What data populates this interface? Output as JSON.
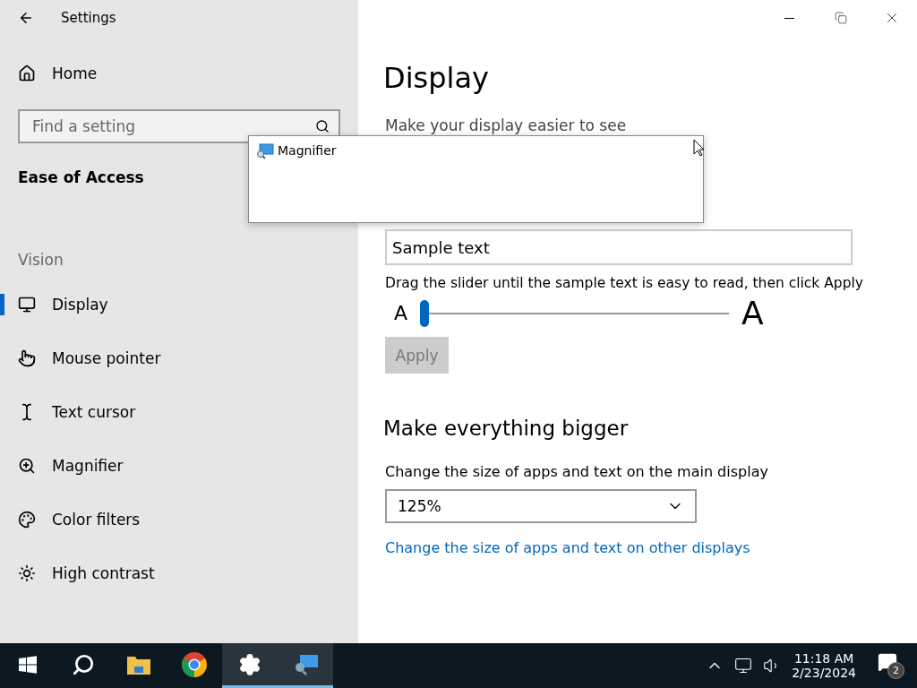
{
  "window": {
    "title": "Settings"
  },
  "sidebar": {
    "home": "Home",
    "search": {
      "placeholder": "Find a setting"
    },
    "section": "Ease of Access",
    "group": "Vision",
    "items": [
      {
        "label": "Display",
        "selected": true
      },
      {
        "label": "Mouse pointer",
        "selected": false
      },
      {
        "label": "Text cursor",
        "selected": false
      },
      {
        "label": "Magnifier",
        "selected": false
      },
      {
        "label": "Color filters",
        "selected": false
      },
      {
        "label": "High contrast",
        "selected": false
      }
    ]
  },
  "main": {
    "title": "Display",
    "subtitle": "Make your display easier to see",
    "sample": {
      "value": "Sample text"
    },
    "slider_hint": "Drag the slider until the sample text is easy to read, then click Apply",
    "slider": {
      "min_label": "A",
      "max_label": "A",
      "level": 0.0
    },
    "apply": {
      "label": "Apply",
      "disabled": true
    },
    "bigger": {
      "heading": "Make everything bigger",
      "hint": "Change the size of apps and text on the main display",
      "dropdown": "125%",
      "link": "Change the size of apps and text on other displays"
    }
  },
  "popup": {
    "title": "Magnifier"
  },
  "taskbar": {
    "apps": [
      {
        "active": false
      },
      {
        "active": false
      },
      {
        "active": true
      },
      {
        "active": true
      }
    ],
    "time": "11:18 AM",
    "date": "2/23/2024",
    "notifications": "2"
  }
}
